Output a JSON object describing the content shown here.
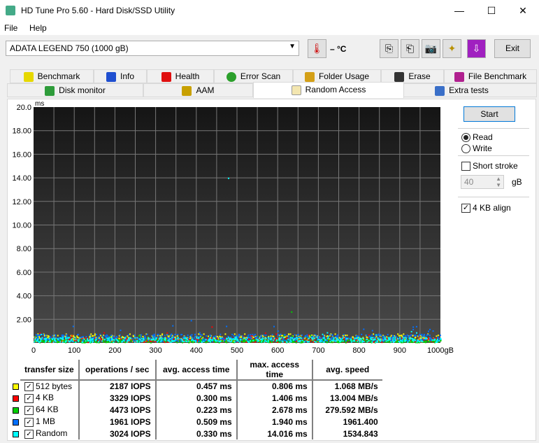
{
  "window": {
    "title": "HD Tune Pro 5.60 - Hard Disk/SSD Utility",
    "minimize": "—",
    "maximize": "☐",
    "close": "✕"
  },
  "menu": {
    "file": "File",
    "help": "Help"
  },
  "toolbar": {
    "drive": "ADATA LEGEND 750 (1000 gB)",
    "temperature": "– °C",
    "exit": "Exit"
  },
  "tabs_row1": [
    {
      "label": "Benchmark",
      "color": "#e6d800"
    },
    {
      "label": "Info",
      "color": "#1f4fd0"
    },
    {
      "label": "Health",
      "color": "#e01010"
    },
    {
      "label": "Error Scan",
      "color": "#2ca02c"
    },
    {
      "label": "Folder Usage",
      "color": "#d4a017"
    },
    {
      "label": "Erase",
      "color": "#333333"
    },
    {
      "label": "File Benchmark",
      "color": "#b0208f"
    }
  ],
  "tabs_row2": [
    {
      "label": "Disk monitor",
      "color": "#2e9c3a"
    },
    {
      "label": "AAM",
      "color": "#c8a000"
    },
    {
      "label": "Random Access",
      "color": "#f3e6b0"
    },
    {
      "label": "Extra tests",
      "color": "#3a6fc8"
    }
  ],
  "active_tab": "Random Access",
  "controls": {
    "start": "Start",
    "read": "Read",
    "write": "Write",
    "mode": "Read",
    "short_stroke": "Short stroke",
    "short_stroke_checked": false,
    "stroke_value": "40",
    "stroke_unit": "gB",
    "align_4kb": "4 KB align",
    "align_4kb_checked": true
  },
  "chart_data": {
    "type": "scatter",
    "ylabel": "ms",
    "xlabel_unit": "gB",
    "xlim": [
      0,
      1000
    ],
    "ylim": [
      0,
      20
    ],
    "x_ticks": [
      "0",
      "100",
      "200",
      "300",
      "400",
      "500",
      "600",
      "700",
      "800",
      "900",
      "1000gB"
    ],
    "y_ticks": [
      "2.00",
      "4.00",
      "6.00",
      "8.00",
      "10.00",
      "12.00",
      "14.00",
      "16.00",
      "18.00",
      "20.0"
    ],
    "grid": true,
    "background": "#1a1a1a",
    "series": [
      {
        "name": "512 bytes",
        "color": "#ffff00",
        "avg_ms": 0.457,
        "max_ms": 0.806
      },
      {
        "name": "4 KB",
        "color": "#ff0000",
        "avg_ms": 0.3,
        "max_ms": 1.406
      },
      {
        "name": "64 KB",
        "color": "#00d000",
        "avg_ms": 0.223,
        "max_ms": 2.678
      },
      {
        "name": "1 MB",
        "color": "#0070ff",
        "avg_ms": 0.509,
        "max_ms": 1.94
      },
      {
        "name": "Random",
        "color": "#00ffff",
        "avg_ms": 0.33,
        "max_ms": 14.016
      }
    ]
  },
  "results": {
    "headers": [
      "transfer size",
      "operations / sec",
      "avg. access time",
      "max. access time",
      "avg. speed"
    ],
    "rows": [
      {
        "size": "512 bytes",
        "color": "#ffff00",
        "checked": "✓",
        "ops": "2187 IOPS",
        "avg": "0.457 ms",
        "max": "0.806 ms",
        "speed": "1.068 MB/s"
      },
      {
        "size": "4 KB",
        "color": "#ff0000",
        "checked": "✓",
        "ops": "3329 IOPS",
        "avg": "0.300 ms",
        "max": "1.406 ms",
        "speed": "13.004 MB/s"
      },
      {
        "size": "64 KB",
        "color": "#00d000",
        "checked": "✓",
        "ops": "4473 IOPS",
        "avg": "0.223 ms",
        "max": "2.678 ms",
        "speed": "279.592 MB/s"
      },
      {
        "size": "1 MB",
        "color": "#0070ff",
        "checked": "✓",
        "ops": "1961 IOPS",
        "avg": "0.509 ms",
        "max": "1.940 ms",
        "speed": "1961.400"
      },
      {
        "size": "Random",
        "color": "#00ffff",
        "checked": "✓",
        "ops": "3024 IOPS",
        "avg": "0.330 ms",
        "max": "14.016 ms",
        "speed": "1534.843"
      }
    ]
  }
}
